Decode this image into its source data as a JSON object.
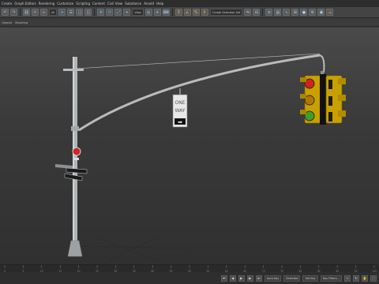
{
  "menu": {
    "items": [
      "Create",
      "Graph Editors",
      "Rendering",
      "Customize",
      "Scripting",
      "Content",
      "Civil View",
      "Substance",
      "Arnold",
      "Help"
    ]
  },
  "toolbar": {
    "selection_filter": "All",
    "named_selection": "Create Selection Set",
    "viewport_label": "View"
  },
  "subbar": {
    "items": [
      "Objects",
      "Modeling"
    ]
  },
  "sign": {
    "line1": "ONE",
    "line2": "WAY",
    "arrow": "➡"
  },
  "timeline": {
    "ticks": [
      "0",
      "5",
      "10",
      "15",
      "20",
      "25",
      "30",
      "35",
      "40",
      "45",
      "50",
      "55",
      "60",
      "65",
      "70",
      "75",
      "80",
      "85",
      "90",
      "95",
      "100"
    ]
  },
  "status": {
    "auto_key": "Auto Key",
    "set_key": "Set Key",
    "selected": "Selected",
    "key_filters": "Key Filters..."
  },
  "colors": {
    "pole": "#b9bcbe",
    "housing": "#c8a000",
    "red": "#d21f1f",
    "amber": "#b07800",
    "green": "#3aa12c"
  }
}
